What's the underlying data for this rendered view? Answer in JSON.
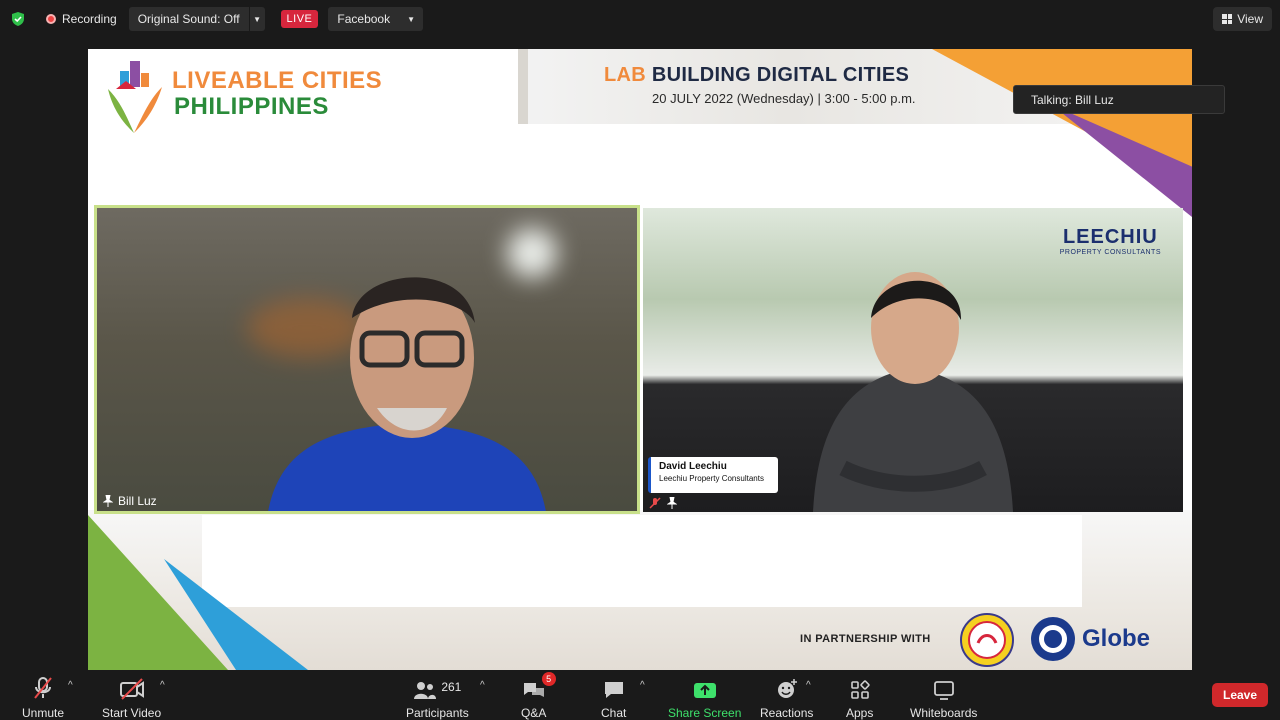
{
  "topbar": {
    "recording_label": "Recording",
    "original_sound_label": "Original Sound: Off",
    "live_label": "LIVE",
    "stream_target": "Facebook",
    "view_label": "View"
  },
  "slide": {
    "brand_line1": "LIVEABLE CITIES",
    "brand_line2": "PHILIPPINES",
    "title_prefix": "LAB",
    "title": "BUILDING DIGITAL CITIES",
    "date": "20 JULY 2022 (Wednesday) | 3:00 - 5:00 p.m.",
    "partnership": "IN PARTNERSHIP WITH",
    "partner2": "Globe",
    "colors": {
      "orange": "#f08a3c",
      "green": "#2a8b3a",
      "purple": "#8c4fa3",
      "blue": "#2e9fd9"
    }
  },
  "talking": "Talking: Bill Luz",
  "tiles": {
    "left": {
      "name": "Bill Luz"
    },
    "right": {
      "logo_main": "LEECHIU",
      "logo_sub": "PROPERTY CONSULTANTS",
      "lower_third_name": "David Leechiu",
      "lower_third_company": "Leechiu Property Consultants"
    }
  },
  "toolbar": {
    "unmute": "Unmute",
    "start_video": "Start Video",
    "participants": "Participants",
    "participant_count": "261",
    "qa": "Q&A",
    "qa_badge": "5",
    "chat": "Chat",
    "share_screen": "Share Screen",
    "reactions": "Reactions",
    "apps": "Apps",
    "whiteboards": "Whiteboards",
    "leave": "Leave"
  }
}
